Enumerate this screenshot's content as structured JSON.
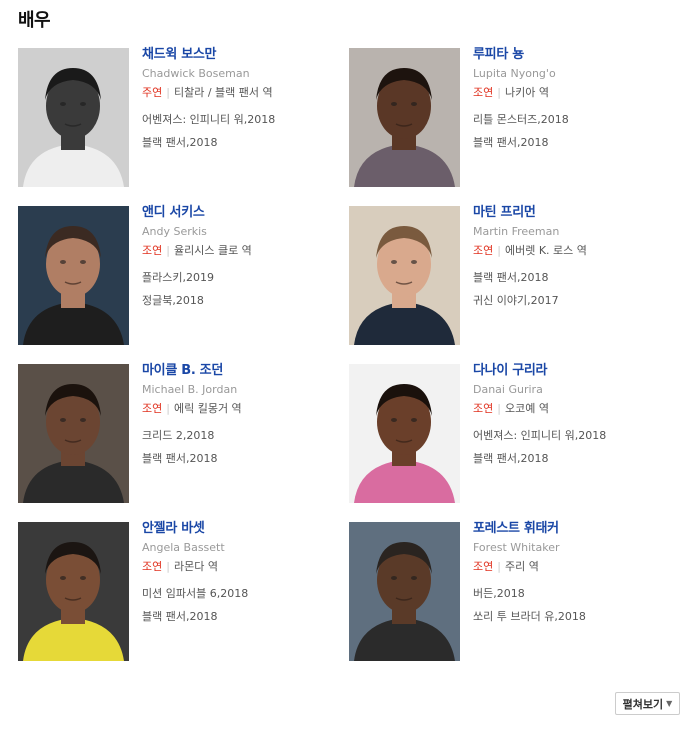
{
  "section": {
    "title": "배우"
  },
  "cast": [
    {
      "name": "채드윅 보스만",
      "name_en": "Chadwick Boseman",
      "role_type": "주연",
      "role": "티찰라 / 블랙 팬서 역",
      "works": [
        "어벤져스: 인피니티 워,2018",
        "블랙 팬서,2018"
      ],
      "photo": {
        "bg": "#cfcfcf",
        "skin": "#3a3a3a",
        "hair": "#1a1a1a",
        "cloth": "#eeeeee",
        "grayscale": true
      }
    },
    {
      "name": "루피타 뇽",
      "name_en": "Lupita Nyong'o",
      "role_type": "조연",
      "role": "나키아 역",
      "works": [
        "리틀 몬스터즈,2018",
        "블랙 팬서,2018"
      ],
      "photo": {
        "bg": "#b9b3ae",
        "skin": "#5a3726",
        "hair": "#1d130e",
        "cloth": "#6b5e6a",
        "grayscale": false
      }
    },
    {
      "name": "앤디 서키스",
      "name_en": "Andy Serkis",
      "role_type": "조연",
      "role": "율리시스 클로 역",
      "works": [
        "플라스키,2019",
        "정글북,2018"
      ],
      "photo": {
        "bg": "#2b3d4f",
        "skin": "#b07e64",
        "hair": "#3b2a22",
        "cloth": "#1e1e1e",
        "grayscale": false
      }
    },
    {
      "name": "마틴 프리먼",
      "name_en": "Martin Freeman",
      "role_type": "조연",
      "role": "에버렛 K. 로스 역",
      "works": [
        "블랙 팬서,2018",
        "귀신 이야기,2017"
      ],
      "photo": {
        "bg": "#d8cdbd",
        "skin": "#d9a98d",
        "hair": "#7a5a3e",
        "cloth": "#1f2a3a",
        "grayscale": false
      }
    },
    {
      "name": "마이클 B. 조던",
      "name_en": "Michael B. Jordan",
      "role_type": "조연",
      "role": "에릭 킬몽거 역",
      "works": [
        "크리드 2,2018",
        "블랙 팬서,2018"
      ],
      "photo": {
        "bg": "#5a5048",
        "skin": "#6b4532",
        "hair": "#1b120d",
        "cloth": "#2a2a2a",
        "grayscale": false
      }
    },
    {
      "name": "다나이 구리라",
      "name_en": "Danai Gurira",
      "role_type": "조연",
      "role": "오코예 역",
      "works": [
        "어벤져스: 인피니티 워,2018",
        "블랙 팬서,2018"
      ],
      "photo": {
        "bg": "#f2f2f2",
        "skin": "#6a3f2a",
        "hair": "#1a110c",
        "cloth": "#d96ca0",
        "grayscale": false
      }
    },
    {
      "name": "안젤라 바셋",
      "name_en": "Angela Bassett",
      "role_type": "조연",
      "role": "라몬다 역",
      "works": [
        "미션 임파서블 6,2018",
        "블랙 팬서,2018"
      ],
      "photo": {
        "bg": "#3a3a3a",
        "skin": "#7a4e36",
        "hair": "#1b1512",
        "cloth": "#e6d938",
        "grayscale": false
      }
    },
    {
      "name": "포레스트 휘태커",
      "name_en": "Forest Whitaker",
      "role_type": "조연",
      "role": "주리 역",
      "works": [
        "버든,2018",
        "쏘리 투 브라더 유,2018"
      ],
      "photo": {
        "bg": "#5f6f7f",
        "skin": "#5a3a28",
        "hair": "#2a2420",
        "cloth": "#2b2b2b",
        "grayscale": false
      }
    }
  ],
  "more_button": {
    "label": "펼쳐보기"
  }
}
